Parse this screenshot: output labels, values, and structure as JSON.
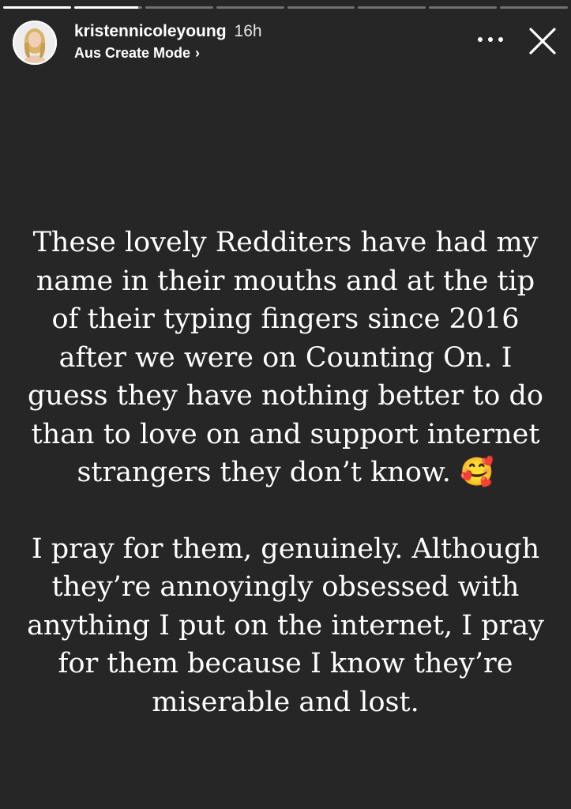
{
  "progress": {
    "segments": [
      1,
      0.95,
      0,
      0,
      0,
      0,
      0,
      0
    ]
  },
  "header": {
    "username": "kristennicoleyoung",
    "time_ago": "16h",
    "audio_label": "Aus Create Mode",
    "audio_chevron": "›"
  },
  "caption": {
    "paragraph1": "These lovely Redditers have had my name in their mouths and at the tip of their typing fingers since 2016 after we were on Counting On. I guess they have nothing better to do than to love on and support internet strangers they don’t know. 🥰",
    "paragraph2": "I pray for them, genuinely. Although they’re annoyingly obsessed with anything I put on the internet, I pray for them because I know they’re miserable and lost."
  },
  "icons": {
    "more": "more-options-icon",
    "close": "close-icon",
    "chevron": "chevron-right-icon"
  },
  "colors": {
    "background": "#262626",
    "text": "#ffffff"
  }
}
